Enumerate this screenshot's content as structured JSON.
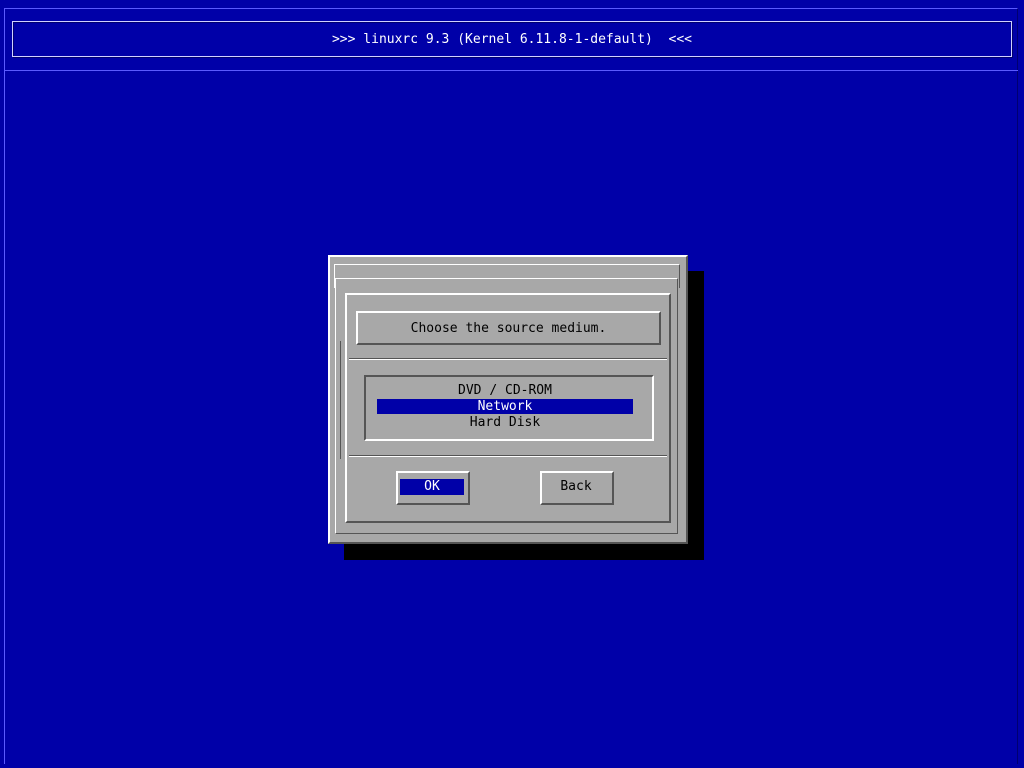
{
  "header": {
    "title": ">>> linuxrc 9.3 (Kernel 6.11.8-1-default)  <<<"
  },
  "dialog": {
    "prompt": "Choose the source medium.",
    "options": [
      {
        "label": "DVD / CD-ROM",
        "selected": false
      },
      {
        "label": "Network",
        "selected": true
      },
      {
        "label": "Hard Disk",
        "selected": false
      }
    ],
    "buttons": {
      "ok_label": "OK",
      "back_label": "Back"
    }
  },
  "colors": {
    "background": "#0000a8",
    "dialog": "#a8a8a8",
    "highlight": "#0000a8",
    "highlight_text": "#ffffff",
    "shadow": "#000000"
  }
}
